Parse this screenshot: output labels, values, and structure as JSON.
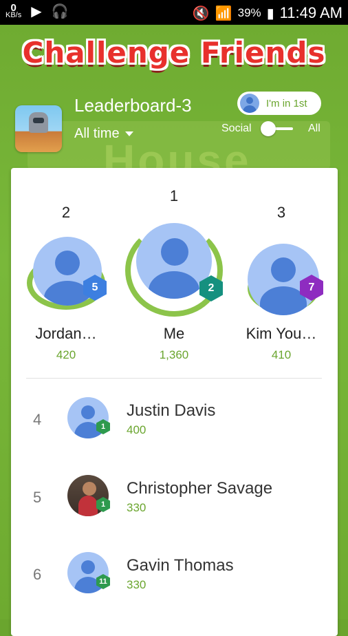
{
  "status_bar": {
    "kbs_value": "0",
    "kbs_unit": "KB/s",
    "battery": "39%",
    "time": "11:49 AM"
  },
  "backdrop_word": "House",
  "title": "Challenge Friends",
  "header": {
    "leaderboard_name": "Leaderboard-3",
    "time_filter": "All time",
    "pill_label": "I'm in 1st",
    "toggle_left": "Social",
    "toggle_right": "All"
  },
  "podium": [
    {
      "rank": "2",
      "name": "Jordan…",
      "score": "420",
      "level": "5",
      "level_color": "#3d7fe0"
    },
    {
      "rank": "1",
      "name": "Me",
      "score": "1,360",
      "level": "2",
      "level_color": "#15907f"
    },
    {
      "rank": "3",
      "name": "Kim You…",
      "score": "410",
      "level": "7",
      "level_color": "#8e2cc0"
    }
  ],
  "rows": [
    {
      "rank": "4",
      "name": "Justin Davis",
      "score": "400",
      "level": "1"
    },
    {
      "rank": "5",
      "name": "Christopher Savage",
      "score": "330",
      "level": "1"
    },
    {
      "rank": "6",
      "name": "Gavin Thomas",
      "score": "330",
      "level": "11"
    }
  ],
  "colors": {
    "accent_green": "#6aa52e",
    "title_red": "#e8302c",
    "avatar_blue": "#4c7fd6"
  }
}
